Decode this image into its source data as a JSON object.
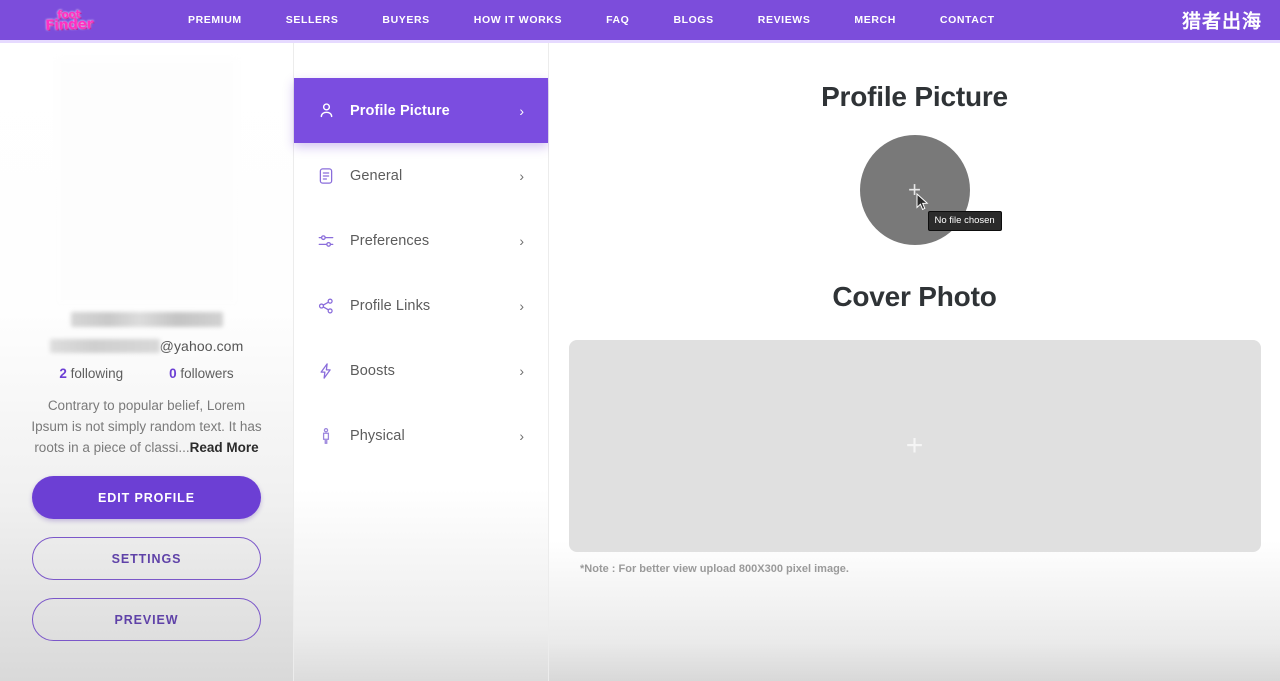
{
  "nav": {
    "logo_line1": "foot",
    "logo_line2": "Finder",
    "items": [
      {
        "label": "PREMIUM"
      },
      {
        "label": "SELLERS"
      },
      {
        "label": "BUYERS"
      },
      {
        "label": "HOW IT WORKS"
      },
      {
        "label": "FAQ"
      },
      {
        "label": "BLOGS"
      },
      {
        "label": "REVIEWS"
      },
      {
        "label": "MERCH"
      },
      {
        "label": "CONTACT"
      }
    ],
    "brand_cn": "猎者出海",
    "bar_color": "#7c4ddb"
  },
  "profile": {
    "username_redacted": "",
    "email_prefix_redacted": "",
    "email_domain": "@yahoo.com",
    "stats": [
      {
        "count": "2",
        "label": "following"
      },
      {
        "count": "0",
        "label": "followers"
      }
    ],
    "bio": "Contrary to popular belief, Lorem Ipsum is not simply random text. It has roots in a piece of classi",
    "bio_ellipsis": "...",
    "read_more": "Read More",
    "buttons": [
      {
        "label": "EDIT PROFILE",
        "style": "primary"
      },
      {
        "label": "SETTINGS",
        "style": "ghost"
      },
      {
        "label": "PREVIEW",
        "style": "ghost"
      }
    ],
    "accent_color": "#6c3fd4"
  },
  "menu": {
    "items": [
      {
        "label": "Profile Picture",
        "icon": "user-icon",
        "active": true,
        "chevron": "›"
      },
      {
        "label": "General",
        "icon": "document-icon",
        "active": false,
        "chevron": "›"
      },
      {
        "label": "Preferences",
        "icon": "sliders-icon",
        "active": false,
        "chevron": "›"
      },
      {
        "label": "Profile Links",
        "icon": "share-icon",
        "active": false,
        "chevron": "›"
      },
      {
        "label": "Boosts",
        "icon": "lightning-icon",
        "active": false,
        "chevron": "›"
      },
      {
        "label": "Physical",
        "icon": "person-standing-icon",
        "active": false,
        "chevron": "›"
      }
    ],
    "active_bg": "#7b4de0",
    "icon_color": "#8a6ddb"
  },
  "content": {
    "profile_picture_title": "Profile Picture",
    "cover_photo_title": "Cover Photo",
    "upload_plus": "+",
    "tooltip": "No file chosen",
    "note": "*Note : For better view upload 800X300 pixel image."
  }
}
